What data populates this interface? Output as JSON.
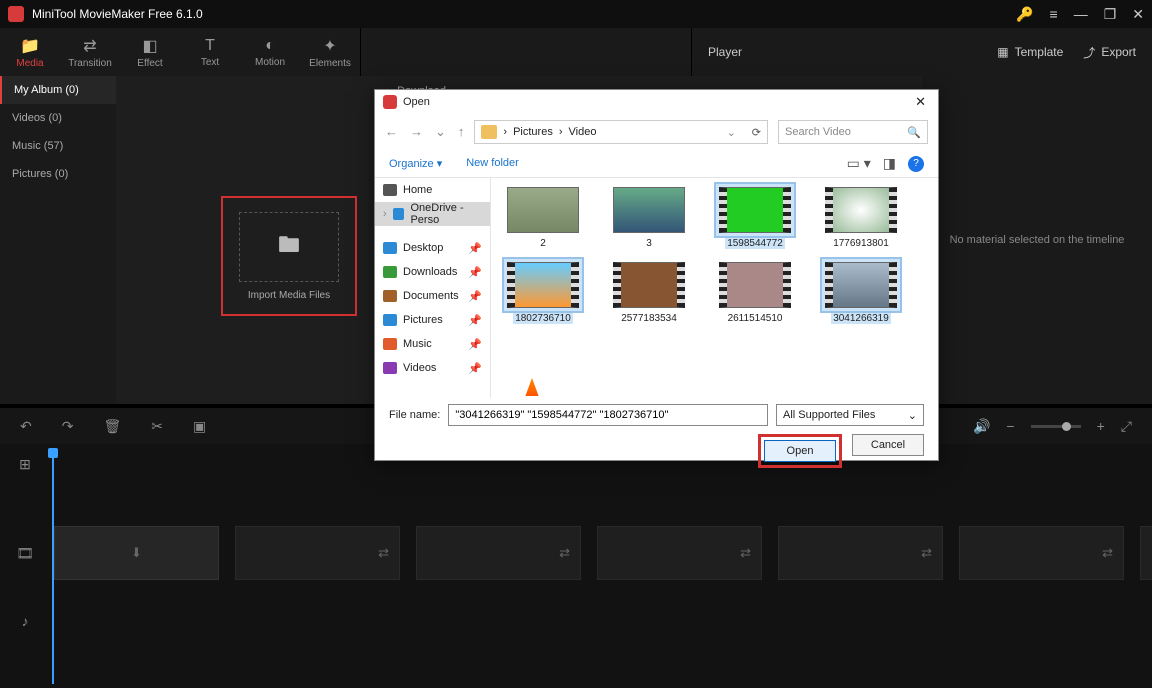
{
  "titlebar": {
    "title": "MiniTool MovieMaker Free 6.1.0"
  },
  "tabs": {
    "media": "Media",
    "transition": "Transition",
    "effect": "Effect",
    "text": "Text",
    "motion": "Motion",
    "elements": "Elements"
  },
  "media_header": {
    "download": "Download"
  },
  "right_toolbar": {
    "player": "Player",
    "template": "Template",
    "export": "Export"
  },
  "sidebar_items": {
    "album": "My Album (0)",
    "videos": "Videos (0)",
    "music": "Music (57)",
    "pictures": "Pictures (0)"
  },
  "import_box": "Import Media Files",
  "right_panel_msg": "No material selected on the timeline",
  "dialog": {
    "title": "Open",
    "breadcrumb": {
      "p1": "Pictures",
      "p2": "Video"
    },
    "search_placeholder": "Search Video",
    "toolbar": {
      "organize": "Organize ▾",
      "newfolder": "New folder"
    },
    "nav": {
      "home": "Home",
      "onedrive": "OneDrive - Perso",
      "desktop": "Desktop",
      "downloads": "Downloads",
      "documents": "Documents",
      "pictures": "Pictures",
      "music": "Music",
      "videos": "Videos"
    },
    "files": {
      "f1": "2",
      "f2": "3",
      "f3": "1598544772",
      "f4": "1776913801",
      "f5": "1802736710",
      "f6": "2577183534",
      "f7": "2611514510",
      "f8": "3041266319"
    },
    "filename_label": "File name:",
    "filename_value": "\"3041266319\" \"1598544772\" \"1802736710\"",
    "filter": "All Supported Files",
    "open_btn": "Open",
    "cancel_btn": "Cancel"
  }
}
